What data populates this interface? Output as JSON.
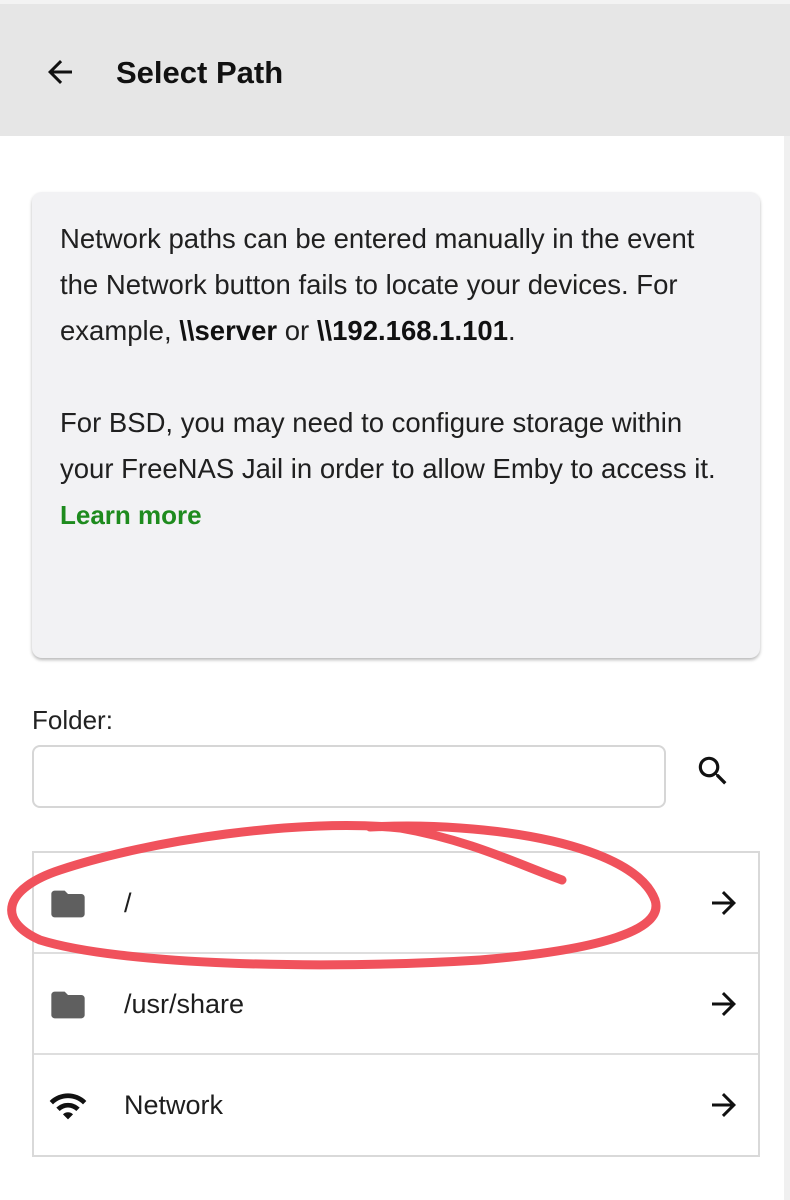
{
  "header": {
    "title": "Select Path",
    "back_icon": "arrow-left-icon"
  },
  "info": {
    "line1_text": "Network paths can be entered manually in the event the Network button fails to locate your devices. For example, ",
    "example1": "\\\\server",
    "or_text": " or ",
    "example2": "\\\\192.168.1.101",
    "period": ".",
    "bsd_text": "For BSD, you may need to configure storage within your FreeNAS Jail in order to allow Emby to access it.",
    "learn_more": "Learn more"
  },
  "folder": {
    "label": "Folder:",
    "value": "",
    "search_icon": "search-icon"
  },
  "paths": [
    {
      "label": "/",
      "icon": "folder-icon"
    },
    {
      "label": "/usr/share",
      "icon": "folder-icon"
    },
    {
      "label": "Network",
      "icon": "wifi-icon"
    }
  ],
  "colors": {
    "header_bg": "#e6e6e6",
    "card_bg": "#f2f2f4",
    "link": "#1e8b1e",
    "annotation": "#f0525c",
    "icon": "#5f5f5f"
  }
}
